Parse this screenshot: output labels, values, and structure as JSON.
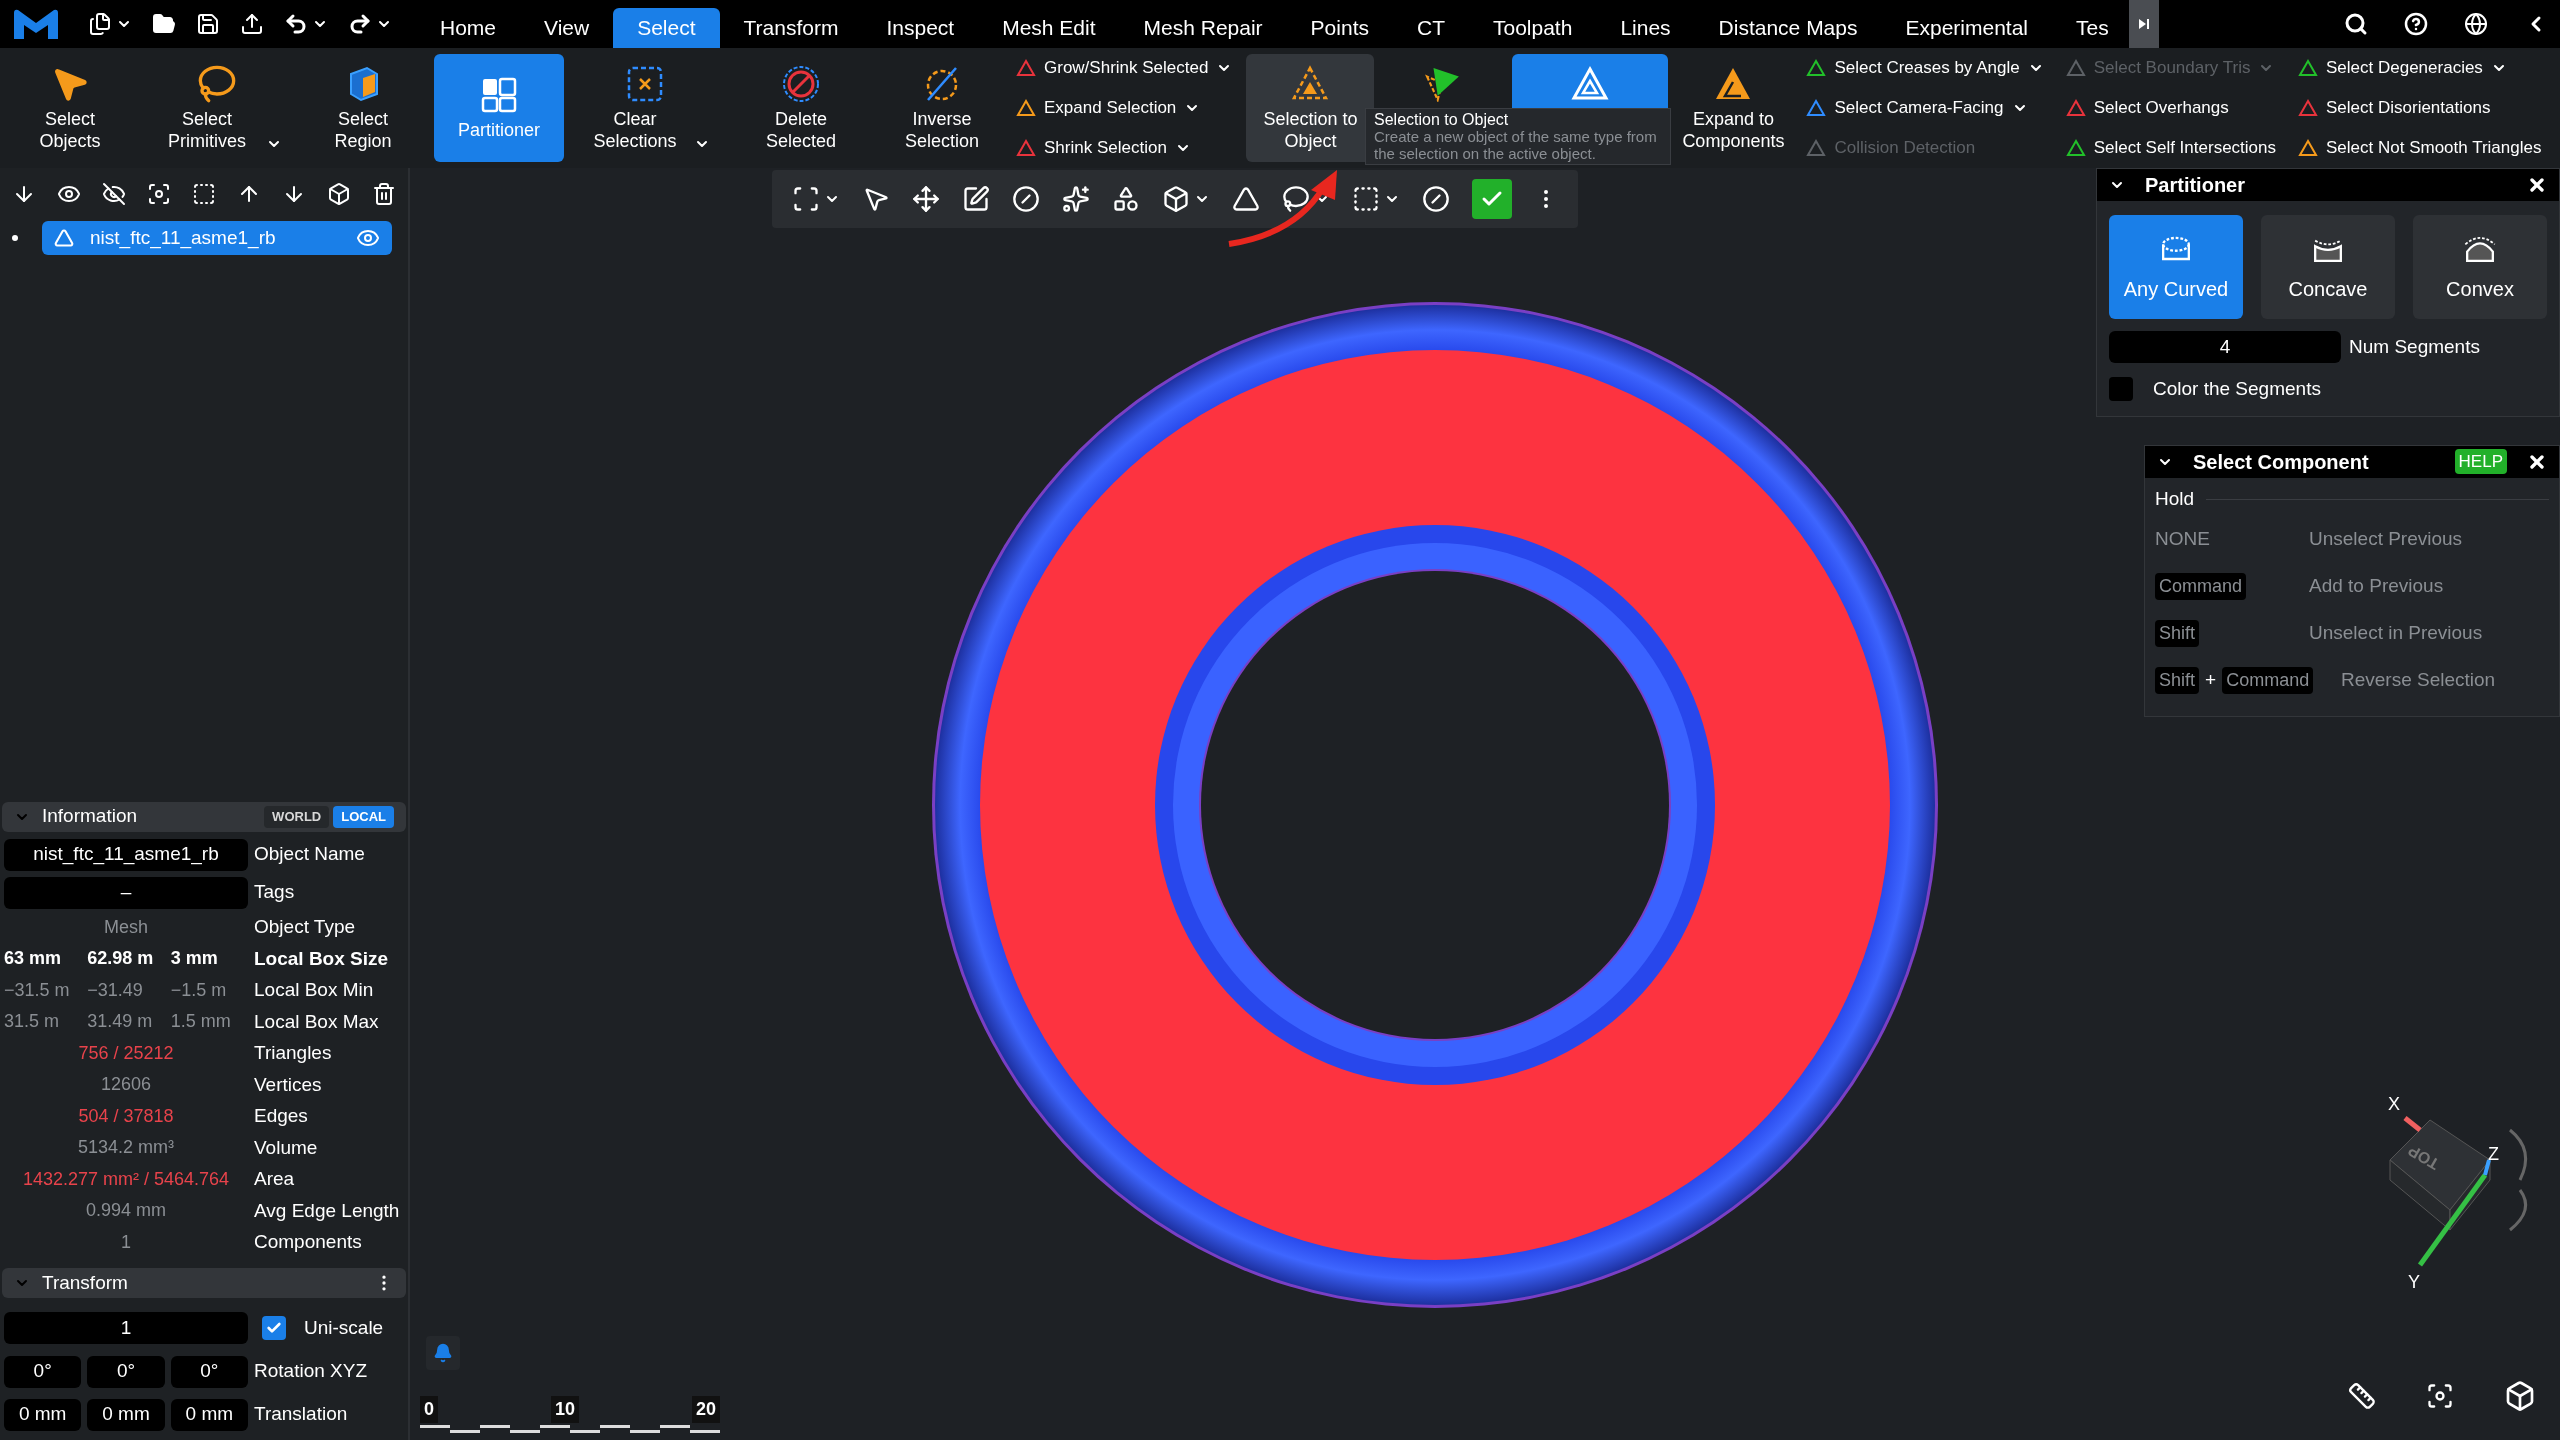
{
  "menu": {
    "tabs": [
      {
        "label": "Home",
        "selected": false
      },
      {
        "label": "View",
        "selected": false
      },
      {
        "label": "Select",
        "selected": true
      },
      {
        "label": "Transform",
        "selected": false
      },
      {
        "label": "Inspect",
        "selected": false
      },
      {
        "label": "Mesh Edit",
        "selected": false
      },
      {
        "label": "Mesh Repair",
        "selected": false
      },
      {
        "label": "Points",
        "selected": false
      },
      {
        "label": "CT",
        "selected": false
      },
      {
        "label": "Toolpath",
        "selected": false
      },
      {
        "label": "Lines",
        "selected": false
      },
      {
        "label": "Distance Maps",
        "selected": false
      },
      {
        "label": "Experimental",
        "selected": false
      },
      {
        "label": "Tes",
        "selected": false
      }
    ]
  },
  "ribbon": [
    {
      "kind": "large",
      "label": "Select Objects",
      "dropdown": false,
      "selected": false,
      "hovered": false
    },
    {
      "kind": "large",
      "label": "Select Primitives",
      "dropdown": true,
      "selected": false,
      "hovered": false
    },
    {
      "kind": "large",
      "label": "Select Region",
      "dropdown": false,
      "selected": false,
      "hovered": false
    },
    {
      "kind": "large",
      "label": "Partitioner",
      "dropdown": false,
      "selected": true,
      "hovered": false
    },
    {
      "kind": "large",
      "label": "Clear Selections",
      "dropdown": true,
      "selected": false,
      "hovered": false
    },
    {
      "kind": "large",
      "label": "Delete Selected",
      "dropdown": false,
      "selected": false,
      "hovered": false
    },
    {
      "kind": "large",
      "label": "Inverse Selection",
      "dropdown": false,
      "selected": false,
      "hovered": false
    },
    {
      "kind": "stack",
      "items": [
        {
          "label": "Grow/Shrink Selected",
          "dropdown": true,
          "disabled": false
        },
        {
          "label": "Expand Selection",
          "dropdown": true,
          "disabled": false
        },
        {
          "label": "Shrink Selection",
          "dropdown": true,
          "disabled": false
        }
      ]
    },
    {
      "kind": "large",
      "label": "Selection to Object",
      "dropdown": false,
      "selected": false,
      "hovered": true
    },
    {
      "kind": "large",
      "dropdown": false,
      "selected": false,
      "hovered": false
    },
    {
      "kind": "large",
      "dropdown": false,
      "selected": true,
      "hovered": false
    },
    {
      "kind": "large",
      "label": "Expand to Components",
      "dropdown": false,
      "selected": false,
      "hovered": false
    },
    {
      "kind": "stack",
      "items": [
        {
          "label": "Select Creases by Angle",
          "dropdown": true,
          "disabled": false
        },
        {
          "label": "Select Camera-Facing",
          "dropdown": true,
          "disabled": false
        },
        {
          "label": "Collision Detection",
          "dropdown": false,
          "disabled": true
        }
      ]
    },
    {
      "kind": "stack",
      "items": [
        {
          "label": "Select Boundary Tris",
          "dropdown": true,
          "disabled": true
        },
        {
          "label": "Select Overhangs",
          "dropdown": false,
          "disabled": false
        },
        {
          "label": "Select Self Intersections",
          "dropdown": false,
          "disabled": false
        }
      ]
    },
    {
      "kind": "stack",
      "items": [
        {
          "label": "Select Degeneracies",
          "dropdown": true,
          "disabled": false
        },
        {
          "label": "Select Disorientations",
          "dropdown": false,
          "disabled": false
        },
        {
          "label": "Select Not Smooth Triangles",
          "dropdown": false,
          "disabled": false
        }
      ]
    }
  ],
  "tooltip": {
    "title": "Selection to Object",
    "text": "Create a new object of the same type from the selection on the active object."
  },
  "scene_tree": {
    "items": [
      {
        "name": "nist_ftc_11_asme1_rb",
        "selected": true,
        "visible": true
      }
    ]
  },
  "information": {
    "title": "Information",
    "frames": [
      {
        "label": "WORLD",
        "selected": false
      },
      {
        "label": "LOCAL",
        "selected": true
      }
    ],
    "rows": [
      {
        "kind": "field",
        "values": [
          "nist_ftc_11_asme1_rb"
        ],
        "label": "Object Name"
      },
      {
        "kind": "field",
        "values": [
          "–"
        ],
        "label": "Tags"
      },
      {
        "kind": "dim",
        "values": [
          "Mesh"
        ],
        "label": "Object Type"
      },
      {
        "kind": "bold",
        "values": [
          "63 mm",
          "62.98 m",
          "3 mm"
        ],
        "label": "Local Box Size"
      },
      {
        "kind": "dim",
        "values": [
          "−31.5 m",
          "−31.49",
          "−1.5 m"
        ],
        "label": "Local Box Min"
      },
      {
        "kind": "dim",
        "values": [
          "31.5 m",
          "31.49 m",
          "1.5 mm"
        ],
        "label": "Local Box Max"
      },
      {
        "kind": "alert",
        "values": [
          "756 / 25212"
        ],
        "label": "Triangles"
      },
      {
        "kind": "dim",
        "values": [
          "12606"
        ],
        "label": "Vertices"
      },
      {
        "kind": "alert",
        "values": [
          "504 / 37818"
        ],
        "label": "Edges"
      },
      {
        "kind": "dim",
        "values": [
          "5134.2 mm³"
        ],
        "label": "Volume"
      },
      {
        "kind": "alert",
        "values": [
          "1432.277 mm² / 5464.764"
        ],
        "label": "Area"
      },
      {
        "kind": "dim",
        "values": [
          "0.994 mm"
        ],
        "label": "Avg Edge Length"
      },
      {
        "kind": "dim",
        "values": [
          "1"
        ],
        "label": "Components"
      }
    ]
  },
  "transform": {
    "title": "Transform",
    "scale": {
      "value": "1",
      "label": "Uni-scale",
      "checked": true
    },
    "rows": [
      {
        "values": [
          "0°",
          "0°",
          "0°"
        ],
        "label": "Rotation XYZ"
      },
      {
        "values": [
          "0 mm",
          "0 mm",
          "0 mm"
        ],
        "label": "Translation"
      }
    ]
  },
  "viewport": {
    "check_button": {
      "on": true
    },
    "scale_labels": [
      "0",
      "10",
      "20"
    ],
    "axes": [
      "X",
      "Y",
      "Z"
    ],
    "cube_face": "TOP"
  },
  "partitioner": {
    "title": "Partitioner",
    "modes": [
      {
        "label": "Any Curved",
        "selected": true
      },
      {
        "label": "Concave",
        "selected": false
      },
      {
        "label": "Convex",
        "selected": false
      }
    ],
    "segments": {
      "value": "4",
      "label": "Num Segments"
    },
    "color_segments": {
      "label": "Color the Segments",
      "checked": false
    }
  },
  "select_component": {
    "title": "Select Component",
    "help": "HELP",
    "hold": "Hold",
    "rows": [
      {
        "keys": [
          "NONE"
        ],
        "plain": true,
        "action": "Unselect Previous"
      },
      {
        "keys": [
          "Command"
        ],
        "plain": false,
        "action": "Add to Previous"
      },
      {
        "keys": [
          "Shift"
        ],
        "plain": false,
        "action": "Unselect in Previous"
      },
      {
        "keys": [
          "Shift",
          "Command"
        ],
        "plain": false,
        "joiner": "+",
        "action": "Reverse Selection"
      }
    ]
  }
}
